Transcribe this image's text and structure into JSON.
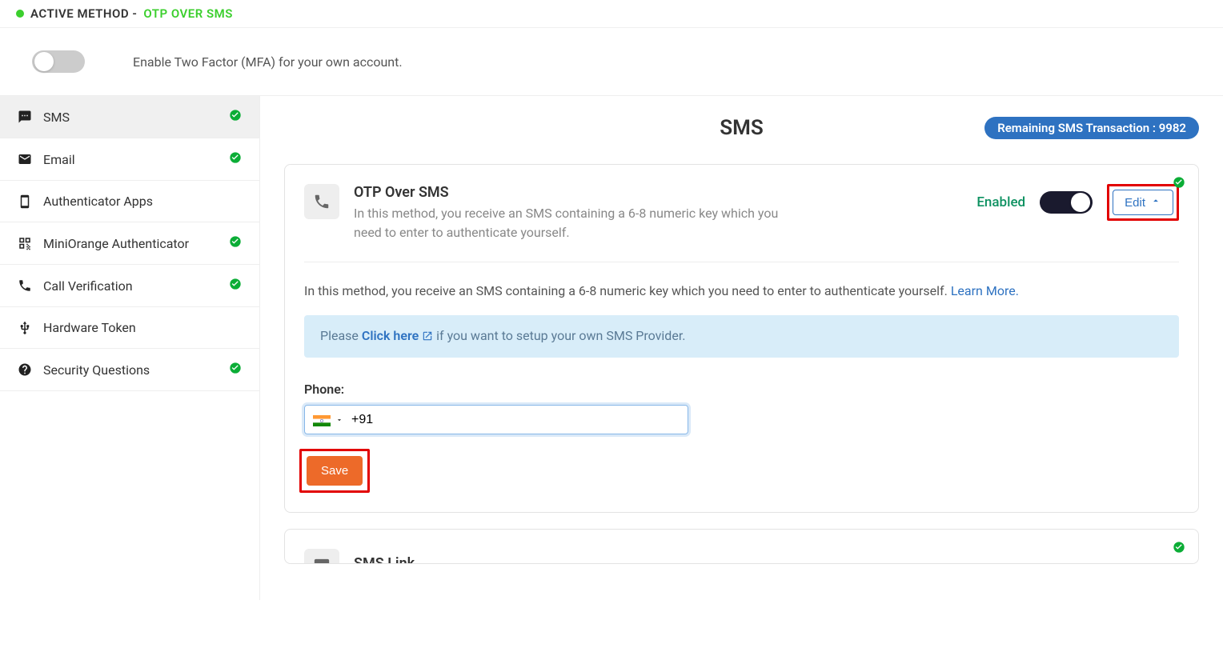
{
  "header": {
    "active_method_label": "ACTIVE METHOD - ",
    "active_method_value": "OTP OVER SMS"
  },
  "enable_mfa_text": "Enable Two Factor (MFA) for your own account.",
  "sidebar": {
    "items": [
      {
        "label": "SMS",
        "has_check": true
      },
      {
        "label": "Email",
        "has_check": true
      },
      {
        "label": "Authenticator Apps",
        "has_check": false
      },
      {
        "label": "MiniOrange Authenticator",
        "has_check": true
      },
      {
        "label": "Call Verification",
        "has_check": true
      },
      {
        "label": "Hardware Token",
        "has_check": false
      },
      {
        "label": "Security Questions",
        "has_check": true
      }
    ]
  },
  "main": {
    "title": "SMS",
    "remaining_label": "Remaining SMS Transaction : 9982"
  },
  "card1": {
    "title": "OTP Over SMS",
    "desc": "In this method, you receive an SMS containing a 6-8 numeric key which you need to enter to authenticate yourself.",
    "enabled": "Enabled",
    "edit": "Edit",
    "body_pre": "In this method, you receive an SMS containing a 6-8 numeric key which you need to enter to authenticate yourself. ",
    "learn_more": "Learn More.",
    "banner_pre": "Please ",
    "banner_link": "Click here ",
    "banner_post": " if you want to setup your own SMS Provider.",
    "phone_label": "Phone:",
    "phone_value": "+91",
    "save": "Save"
  },
  "card2": {
    "title": "SMS Link"
  }
}
